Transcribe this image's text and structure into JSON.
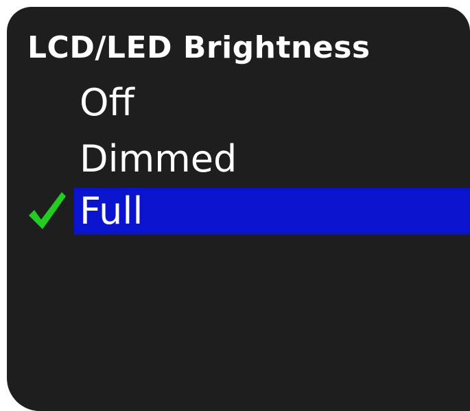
{
  "menu": {
    "title": "LCD/LED Brightness",
    "options": [
      {
        "label": "Off",
        "selected": false
      },
      {
        "label": "Dimmed",
        "selected": false
      },
      {
        "label": "Full",
        "selected": true
      }
    ]
  },
  "colors": {
    "background": "#1e1e1e",
    "text": "#ffffff",
    "highlight": "#0a14cf",
    "check": "#22cc22"
  },
  "icons": {
    "selected_marker": "checkmark-icon"
  }
}
